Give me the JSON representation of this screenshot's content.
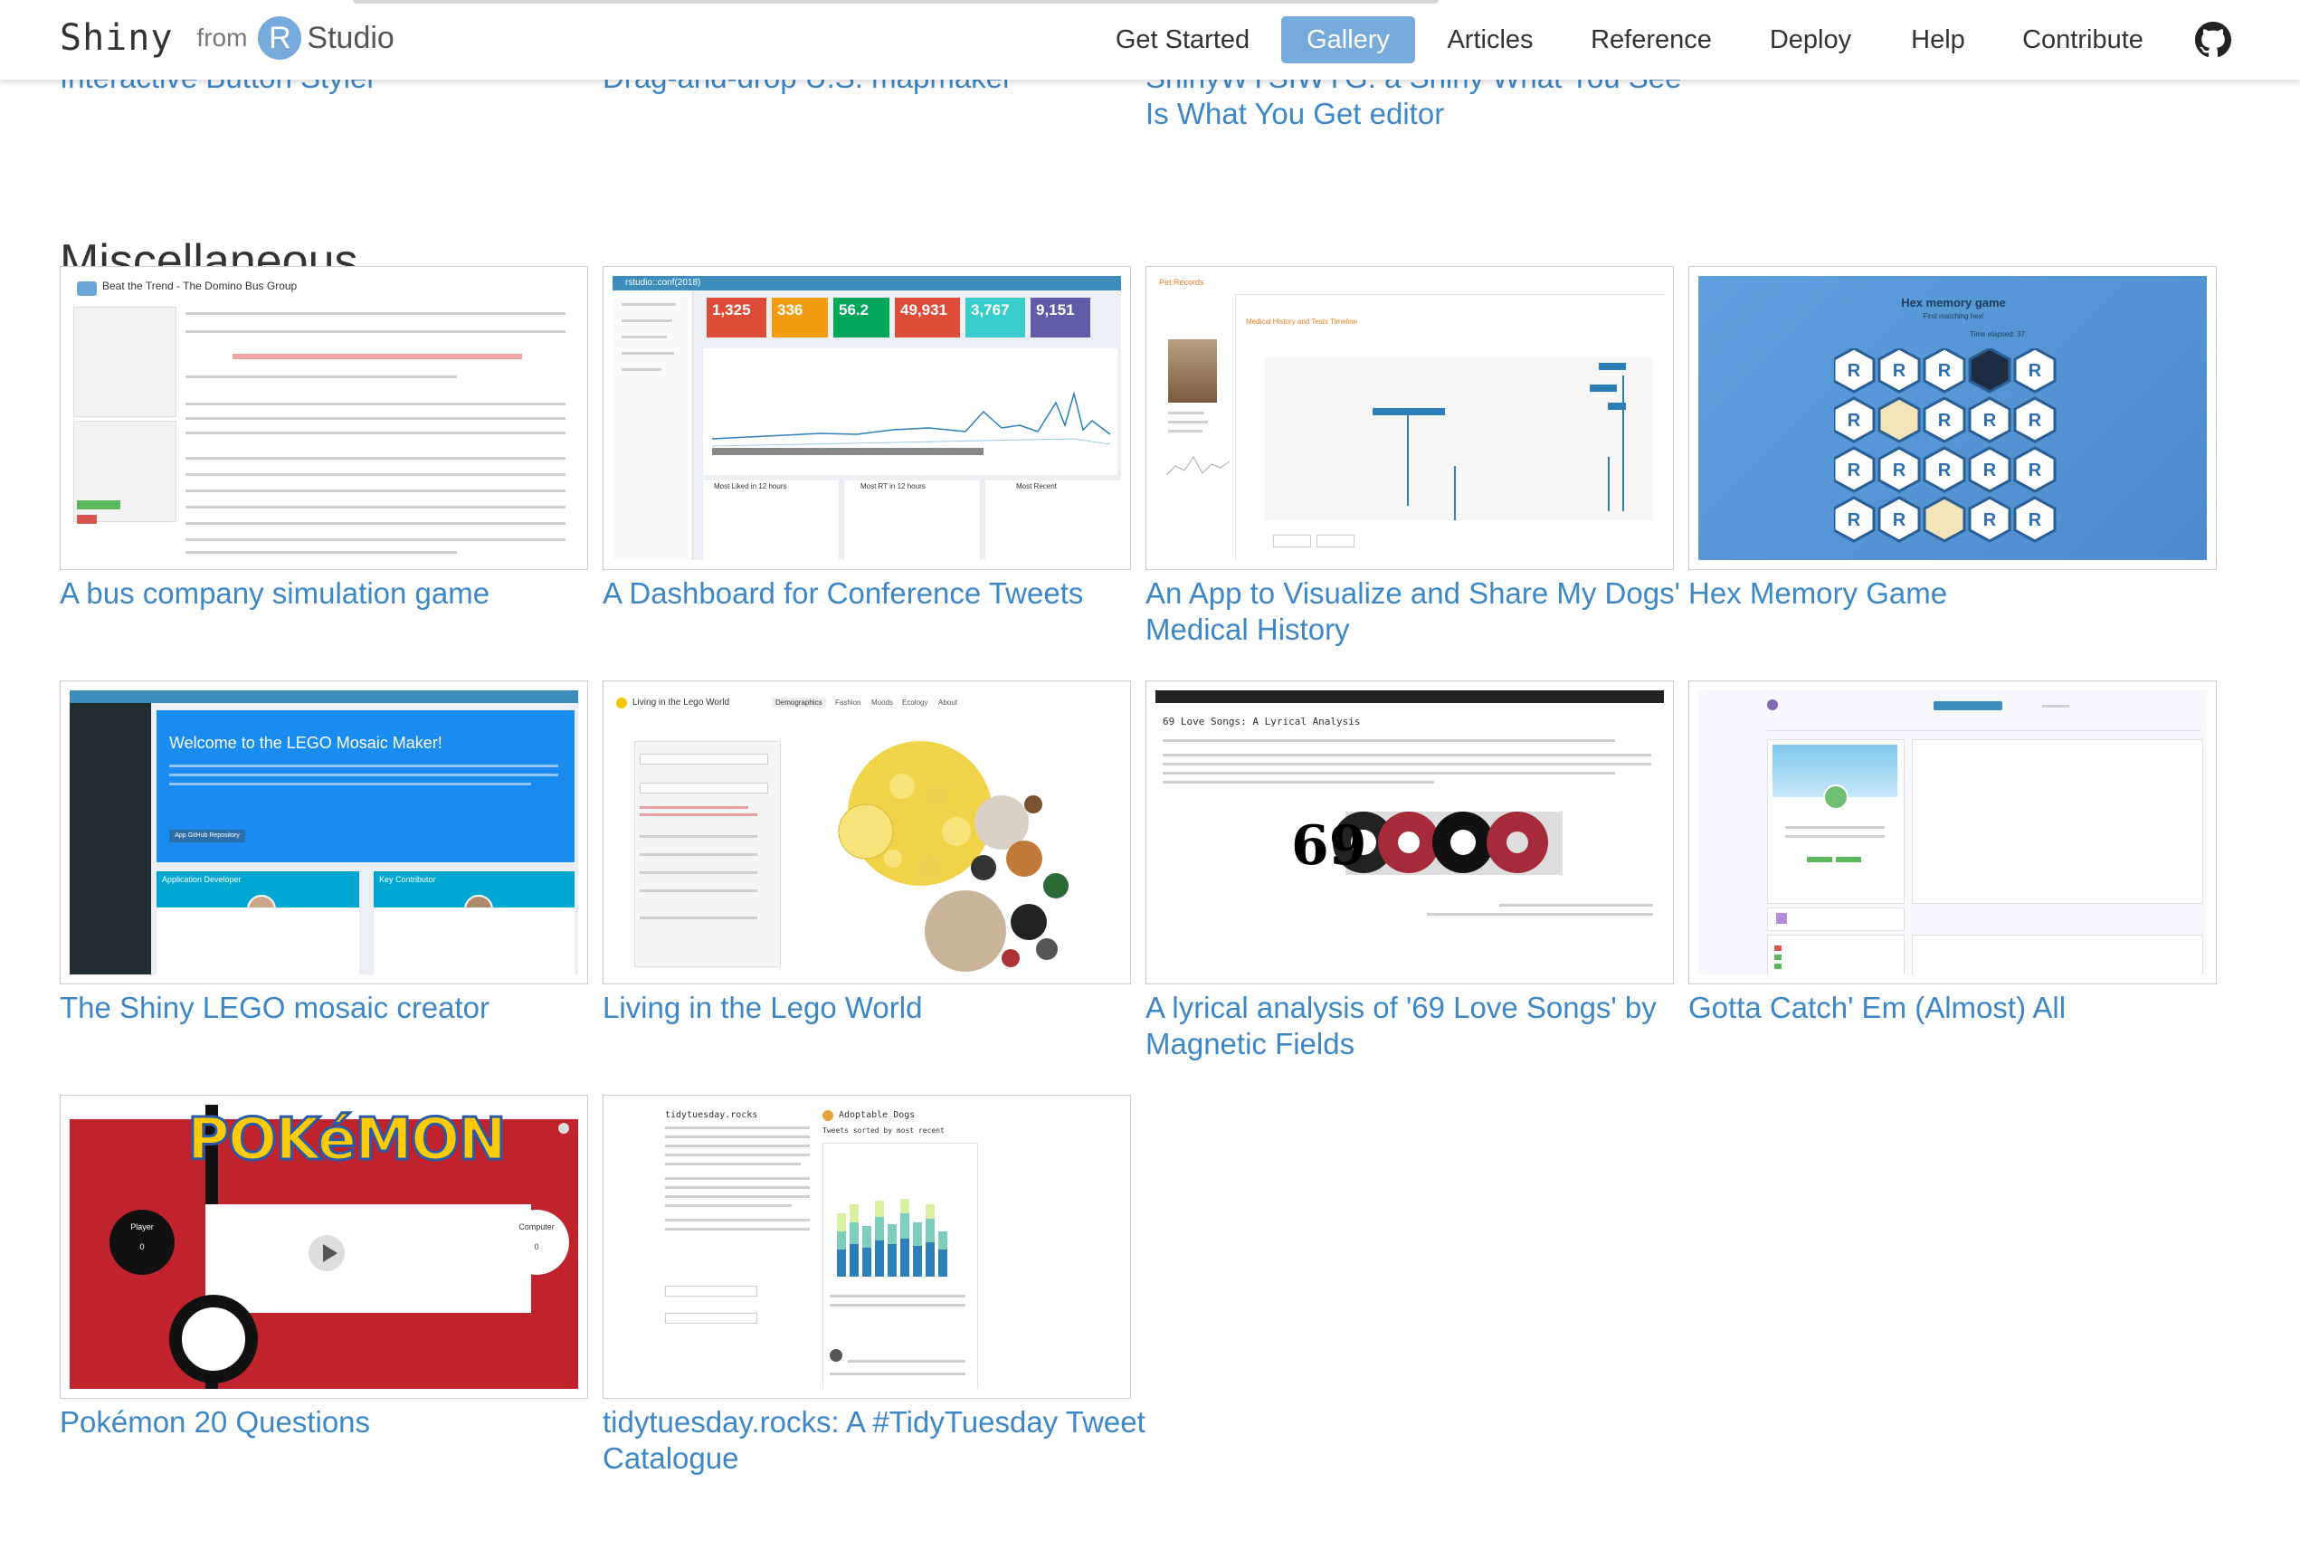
{
  "brand": {
    "name": "Shiny",
    "from": "from",
    "r": "R",
    "studio": "Studio"
  },
  "nav": {
    "items": [
      "Get Started",
      "Gallery",
      "Articles",
      "Reference",
      "Deploy",
      "Help",
      "Contribute"
    ],
    "active": "Gallery",
    "github_icon": "github-icon"
  },
  "previous_section": {
    "titles": [
      "Interactive Button Styler",
      "Drag-and-drop U.S. mapmaker",
      "ShinyWYSIWYG: a Shiny What You See",
      "Is What You Get editor"
    ]
  },
  "section": {
    "title": "Miscellaneous",
    "cards": [
      {
        "title": "A bus company simulation game"
      },
      {
        "title": "A Dashboard for Conference Tweets"
      },
      {
        "title": "An App to Visualize and Share My Dogs' Medical History"
      },
      {
        "title": "Hex Memory Game"
      },
      {
        "title": "The Shiny LEGO mosaic creator"
      },
      {
        "title": "Living in the Lego World"
      },
      {
        "title": "A lyrical analysis of '69 Love Songs' by Magnetic Fields"
      },
      {
        "title": "Gotta Catch' Em (Almost) All"
      },
      {
        "title": "Pokémon 20 Questions"
      },
      {
        "title": "tidytuesday.rocks: A #TidyTuesday Tweet Catalogue"
      }
    ]
  },
  "thumbs": {
    "bus": {
      "header": "Beat the Trend - The Domino Bus Group"
    },
    "conf": {
      "brand": "rstudio::conf(2018)",
      "stats": [
        "1,325",
        "336",
        "56.2",
        "49,931",
        "3,767",
        "9,151"
      ],
      "sections": [
        "Most Liked in 12 hours",
        "Most RT in 12 hours",
        "Most Recent"
      ]
    },
    "dogs": {
      "header": "Pet Records",
      "panel": "Medical History and Tests Timeline"
    },
    "hex": {
      "title": "Hex memory game",
      "subtitle": "Find matching hex!",
      "time": "Time elapsed: 37"
    },
    "lego": {
      "welcome": "Welcome to the LEGO Mosaic Maker!",
      "button": "App GitHub Repository",
      "left_box": "Application Developer",
      "right_box": "Key Contributor"
    },
    "legoworld": {
      "title": "Living in the Lego World",
      "tabs": [
        "Demographics",
        "Fashion",
        "Moods",
        "Ecology",
        "About"
      ]
    },
    "songs": {
      "title": "69 Love Songs: A Lyrical Analysis",
      "logo": "69"
    },
    "pokemon": {
      "logo": "POKéMON",
      "player": "Player",
      "computer": "Computer",
      "score_player": "0",
      "score_computer": "0"
    },
    "tidy": {
      "title": "tidytuesday.rocks",
      "right_title": "Adoptable Dogs",
      "right_sub": "Tweets sorted by most recent"
    }
  },
  "colors": {
    "accent": "#75aadb",
    "link": "#3d87c7",
    "lego_blue": "#1a8cf0",
    "pokemon_red": "#c0232c",
    "hex_bg": "#5b9bd8"
  }
}
